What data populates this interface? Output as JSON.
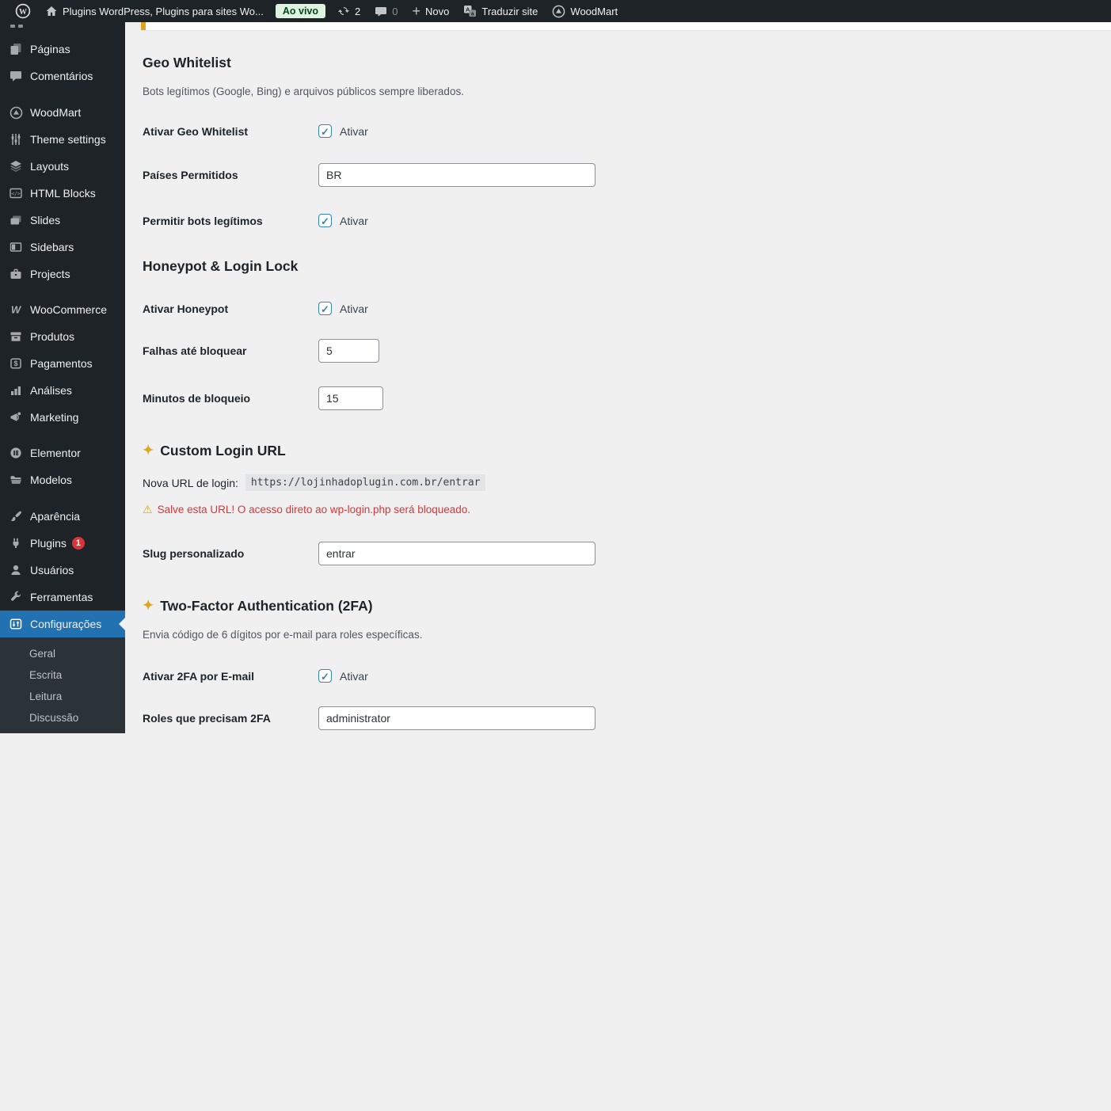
{
  "topbar": {
    "site_title": "Plugins WordPress, Plugins para sites Wo...",
    "env_badge": "Ao vivo",
    "update_count": "2",
    "comment_count": "0",
    "plus_glyph": "+",
    "new_label": "Novo",
    "translate_label": "Traduzir site",
    "woodmart_label": "WoodMart"
  },
  "sidebar": {
    "items": [
      {
        "label": "Páginas"
      },
      {
        "label": "Comentários"
      },
      {
        "label": "WoodMart"
      },
      {
        "label": "Theme settings"
      },
      {
        "label": "Layouts"
      },
      {
        "label": "HTML Blocks"
      },
      {
        "label": "Slides"
      },
      {
        "label": "Sidebars"
      },
      {
        "label": "Projects"
      },
      {
        "label": "WooCommerce"
      },
      {
        "label": "Produtos"
      },
      {
        "label": "Pagamentos"
      },
      {
        "label": "Análises"
      },
      {
        "label": "Marketing"
      },
      {
        "label": "Elementor"
      },
      {
        "label": "Modelos"
      },
      {
        "label": "Aparência"
      },
      {
        "label": "Plugins",
        "badge": "1"
      },
      {
        "label": "Usuários"
      },
      {
        "label": "Ferramentas"
      },
      {
        "label": "Configurações",
        "active": true
      }
    ],
    "submenu": [
      "Geral",
      "Escrita",
      "Leitura",
      "Discussão"
    ]
  },
  "main": {
    "geo": {
      "title": "Geo Whitelist",
      "description": "Bots legítimos (Google, Bing) e arquivos públicos sempre liberados.",
      "enable": {
        "label": "Ativar Geo Whitelist",
        "checkbox_label": "Ativar",
        "checked": true
      },
      "countries": {
        "label": "Países Permitidos",
        "value": "BR"
      },
      "bots": {
        "label": "Permitir bots legítimos",
        "checkbox_label": "Ativar",
        "checked": true
      }
    },
    "honeypot": {
      "title": "Honeypot & Login Lock",
      "enable": {
        "label": "Ativar Honeypot",
        "checkbox_label": "Ativar",
        "checked": true
      },
      "failures": {
        "label": "Falhas até bloquear",
        "value": "5"
      },
      "minutes": {
        "label": "Minutos de bloqueio",
        "value": "15"
      }
    },
    "login_url": {
      "sparkle": "✦",
      "title": "Custom Login URL",
      "url_label": "Nova URL de login:",
      "url_value": "https://lojinhadoplugin.com.br/entrar",
      "warning_icon": "⚠",
      "warning": "Salve esta URL! O acesso direto ao wp-login.php será bloqueado.",
      "slug": {
        "label": "Slug personalizado",
        "value": "entrar"
      }
    },
    "tfa": {
      "sparkle": "✦",
      "title": "Two-Factor Authentication (2FA)",
      "description": "Envia código de 6 dígitos por e-mail para roles específicas.",
      "enable": {
        "label": "Ativar 2FA por E-mail",
        "checkbox_label": "Ativar",
        "checked": true
      },
      "roles": {
        "label": "Roles que precisam 2FA",
        "value": "administrator"
      }
    }
  },
  "colors": {
    "accent_blue": "#2271b1",
    "checkbox_blue": "#3582c4",
    "warning_red": "#d63638",
    "notice_orange": "#dba617",
    "env_badge_bg": "#dff3e2",
    "env_badge_text": "#00491f",
    "admin_dark": "#1d2327",
    "submenu_dark": "#2c3338",
    "page_bg": "#f0f0f1"
  }
}
